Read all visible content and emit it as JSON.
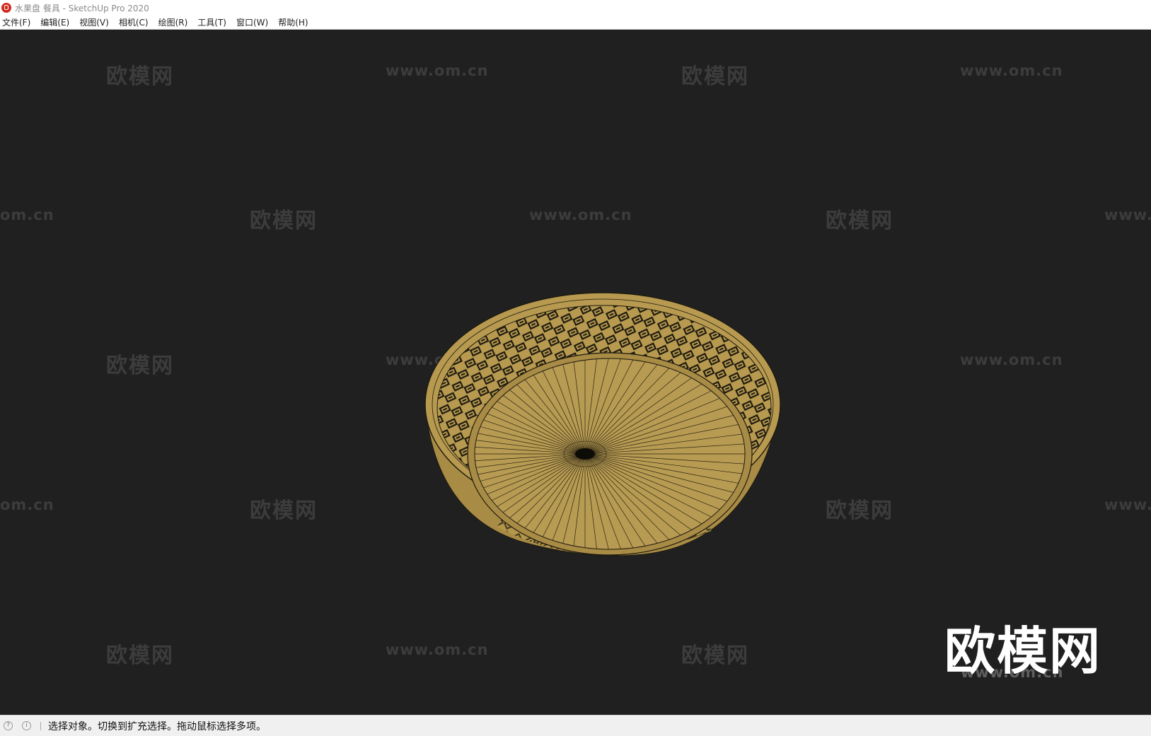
{
  "window": {
    "title": "水果盘 餐具 - SketchUp Pro 2020"
  },
  "menubar": {
    "items": [
      "文件(F)",
      "编辑(E)",
      "视图(V)",
      "相机(C)",
      "绘图(R)",
      "工具(T)",
      "窗口(W)",
      "帮助(H)"
    ]
  },
  "watermark": {
    "brand": "欧模网",
    "url": "www.om.cn",
    "url_partial_left": "om.cn",
    "url_partial_right": "www.",
    "logo_brand": "欧模网",
    "logo_url": "www.om.cn"
  },
  "model": {
    "subject": "wicker fruit bowl",
    "fill_color": "#b79a4f",
    "edge_color": "#1e1a10",
    "background_color": "#202020"
  },
  "statusbar": {
    "message": "选择对象。切换到扩充选择。拖动鼠标选择多项。",
    "icon_left": "geo-location-icon",
    "icon_info": "info-icon"
  }
}
